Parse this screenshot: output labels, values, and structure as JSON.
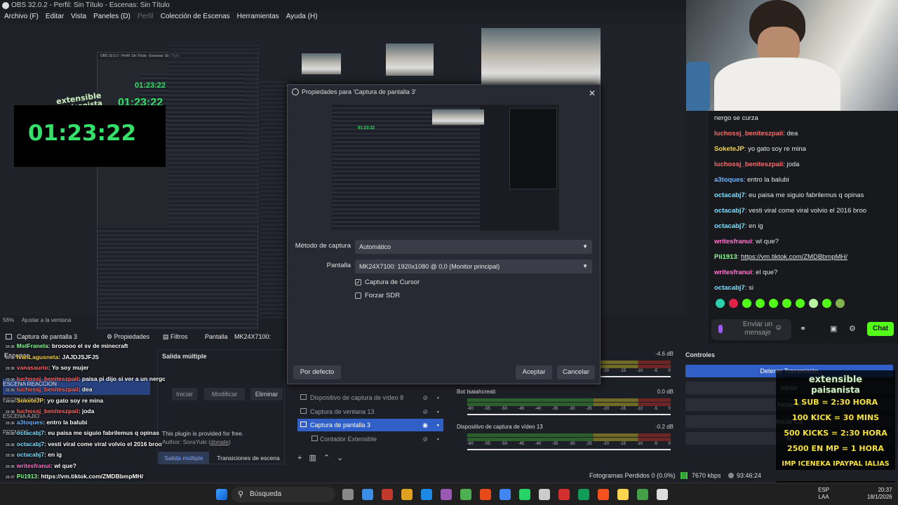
{
  "window": {
    "title": "OBS 32.0.2 - Perfil: Sin Título - Escenas: Sin Título"
  },
  "menu": [
    {
      "label": "Archivo (F)",
      "dim": false
    },
    {
      "label": "Editar",
      "dim": false
    },
    {
      "label": "Vista",
      "dim": false
    },
    {
      "label": "Paneles (D)",
      "dim": false
    },
    {
      "label": "Perfil",
      "dim": true
    },
    {
      "label": "Colección de Escenas",
      "dim": false
    },
    {
      "label": "Herramientas",
      "dim": false
    },
    {
      "label": "Ayuda (H)",
      "dim": false
    }
  ],
  "preview": {
    "timer": "01:23:22",
    "badge_line1": "extensible",
    "badge_line2": "paisanista",
    "zoom": "56%",
    "zoom_fit": "Ajustar a la ventana"
  },
  "source_toolbar": {
    "source_name": "Captura de pantalla 3",
    "properties": "Propiedades",
    "filters": "Filtros",
    "screen_label": "Pantalla",
    "screen_value": "MK24X7100: 1920x1"
  },
  "dialog": {
    "title": "Propiedades para 'Captura de pantalla 3'",
    "method_label": "Método de captura",
    "method_value": "Automático",
    "screen_label": "Pantalla",
    "screen_value": "MK24X7100: 1920x1080 @ 0,0 (Monitor principal)",
    "cursor_label": "Captura de Cursor",
    "cursor_checked": true,
    "sdr_label": "Forzar SDR",
    "sdr_checked": false,
    "defaults_button": "Por defecto",
    "accept_button": "Aceptar",
    "cancel_button": "Cancelar"
  },
  "docks": {
    "scenes_title": "Escenas",
    "scenes": [
      "ESCENA REACCION",
      "ESCENA OMP",
      "ESCENA AJIO",
      "PREMIOS"
    ],
    "multi_title": "Salida múltiple",
    "multi_start": "Iniciar",
    "multi_modify": "Modificar",
    "multi_delete": "Eliminar",
    "plugin_text": "This plugin is provided for free.",
    "plugin_author": "Author: SoraYuki",
    "plugin_donate": "donate",
    "tab_multi": "Salida múltiple",
    "tab_transitions": "Transiciones de escena",
    "sources": [
      {
        "name": "Dispositivo de captura de vídeo 8",
        "selected": false
      },
      {
        "name": "Captura de ventana 13",
        "selected": false
      },
      {
        "name": "Captura de pantalla 3",
        "selected": true
      },
      {
        "name": "Contador Extensible",
        "selected": false
      }
    ],
    "mixer": [
      {
        "name": "",
        "db": "-4.6 dB"
      },
      {
        "name": "Bot Isaiahcreati",
        "db": "0.0 dB"
      },
      {
        "name": "Dispositivo de captura de vídeo 13",
        "db": "-0.2 dB"
      }
    ],
    "mixer_ticks": [
      "-60",
      "-55",
      "-50",
      "-45",
      "-40",
      "-35",
      "-30",
      "-25",
      "-20",
      "-15",
      "-10",
      "-5",
      "0"
    ],
    "controls_title": "Controles",
    "controls": [
      {
        "label": "Detener Transmisión",
        "primary": true
      },
      {
        "label": "Iniciar",
        "primary": false
      },
      {
        "label": "Iniciar el",
        "primary": false
      },
      {
        "label": "Iniciar Ca",
        "primary": false
      },
      {
        "label": "M",
        "primary": false
      }
    ]
  },
  "chat": {
    "first_line": "nergo se curza",
    "messages": [
      {
        "user": "luchossj_beniteszpaii",
        "text": "dea",
        "color": "#ff6b6b"
      },
      {
        "user": "SoketeJP",
        "text": "yo gato soy re mina",
        "color": "#f5d547"
      },
      {
        "user": "luchossj_beniteszpaii",
        "text": "joda",
        "color": "#ff6b6b"
      },
      {
        "user": "a3toques",
        "text": "entro la balubi",
        "color": "#6fb5ff"
      },
      {
        "user": "octacabj7",
        "text": "eu paisa me siguio fabrilemus q opinas",
        "color": "#7ee0ff"
      },
      {
        "user": "octacabj7",
        "text": "vesti viral come viral volvio el 2016 broo",
        "color": "#7ee0ff"
      },
      {
        "user": "octacabj7",
        "text": "en ig",
        "color": "#7ee0ff"
      },
      {
        "user": "writesfranui",
        "text": "wl que?",
        "color": "#ff7ad0"
      },
      {
        "user": "Pii1913",
        "text": "https://vm.tiktok.com/ZMDBbmpMH/",
        "color": "#8dff9a",
        "link": true
      },
      {
        "user": "writesfranui",
        "text": "el que?",
        "color": "#ff7ad0"
      },
      {
        "user": "octacabj7",
        "text": "si",
        "color": "#7ee0ff"
      }
    ],
    "input_placeholder": "Enviar un mensaje",
    "send_label": "Chat"
  },
  "overlay_chat": [
    {
      "time": "20:36",
      "user": "MstFranela",
      "text": "brooooo el sv de minecraft",
      "color": "#8dff9a"
    },
    {
      "time": "20:36",
      "user": "IvanLagusneta",
      "text": "JAJDJSJFJS",
      "color": "#f5d547"
    },
    {
      "time": "20:36",
      "user": "vanasaurio",
      "text": "Yo soy mujer",
      "color": "#ff6b6b"
    },
    {
      "time": "20:36",
      "user": "luchossj_beniteszpaii",
      "text": "paisa pi dijo si ver a un nergo se curza",
      "color": "#ff6b6b"
    },
    {
      "time": "20:36",
      "user": "luchossj_beniteszpaii",
      "text": "dea",
      "color": "#ff6b6b"
    },
    {
      "time": "20:36",
      "user": "SoketeJP",
      "text": "yo gato soy re mina",
      "color": "#f5d547"
    },
    {
      "time": "20:36",
      "user": "luchossj_beniteszpaii",
      "text": "joda",
      "color": "#ff6b6b"
    },
    {
      "time": "20:36",
      "user": "a3toques",
      "text": "entro la balubi",
      "color": "#6fb5ff"
    },
    {
      "time": "20:36",
      "user": "octacabj7",
      "text": "eu paisa me siguio fabrilemus q opinas",
      "color": "#7ee0ff"
    },
    {
      "time": "20:36",
      "user": "octacabj7",
      "text": "vesti viral come viral volvio el 2016 broo",
      "color": "#7ee0ff"
    },
    {
      "time": "20:36",
      "user": "octacabj7",
      "text": "en ig",
      "color": "#7ee0ff"
    },
    {
      "time": "20:36",
      "user": "writesfranui",
      "text": "wl que?",
      "color": "#ff7ad0"
    },
    {
      "time": "20:37",
      "user": "Pii1913",
      "text": "https://vm.tiktok.com/ZMDBbmpMH/",
      "color": "#8dff9a"
    },
    {
      "time": "20:37",
      "user": "writesfranui",
      "text": "el que?",
      "color": "#ff7ad0"
    },
    {
      "time": "20:37",
      "user": "octacabj7",
      "text": "si",
      "color": "#7ee0ff"
    }
  ],
  "promo": {
    "line1": "extensible",
    "line2": "paisanista",
    "lines": [
      "1 SUB = 2:30 HORA",
      "100 KICK = 30 MINS",
      "500 KICKS = 2:30 HORA",
      "2500 EN MP = 1 HORA",
      "IMP ICENEKA IPAYPAL IALIAS"
    ]
  },
  "status": {
    "dropped": "Fotogramas Perdidos 0 (0.0%)",
    "bitrate": "7670 kbps",
    "live_time": "93:46:24"
  },
  "taskbar": {
    "search": "Búsqueda",
    "lang1": "ESP",
    "lang2": "LAA",
    "time": "20:37",
    "date": "18/1/2026"
  },
  "colors": {
    "accent": "#2f5fc7",
    "kick_green": "#53fc18",
    "timer_green": "#35e06a"
  }
}
